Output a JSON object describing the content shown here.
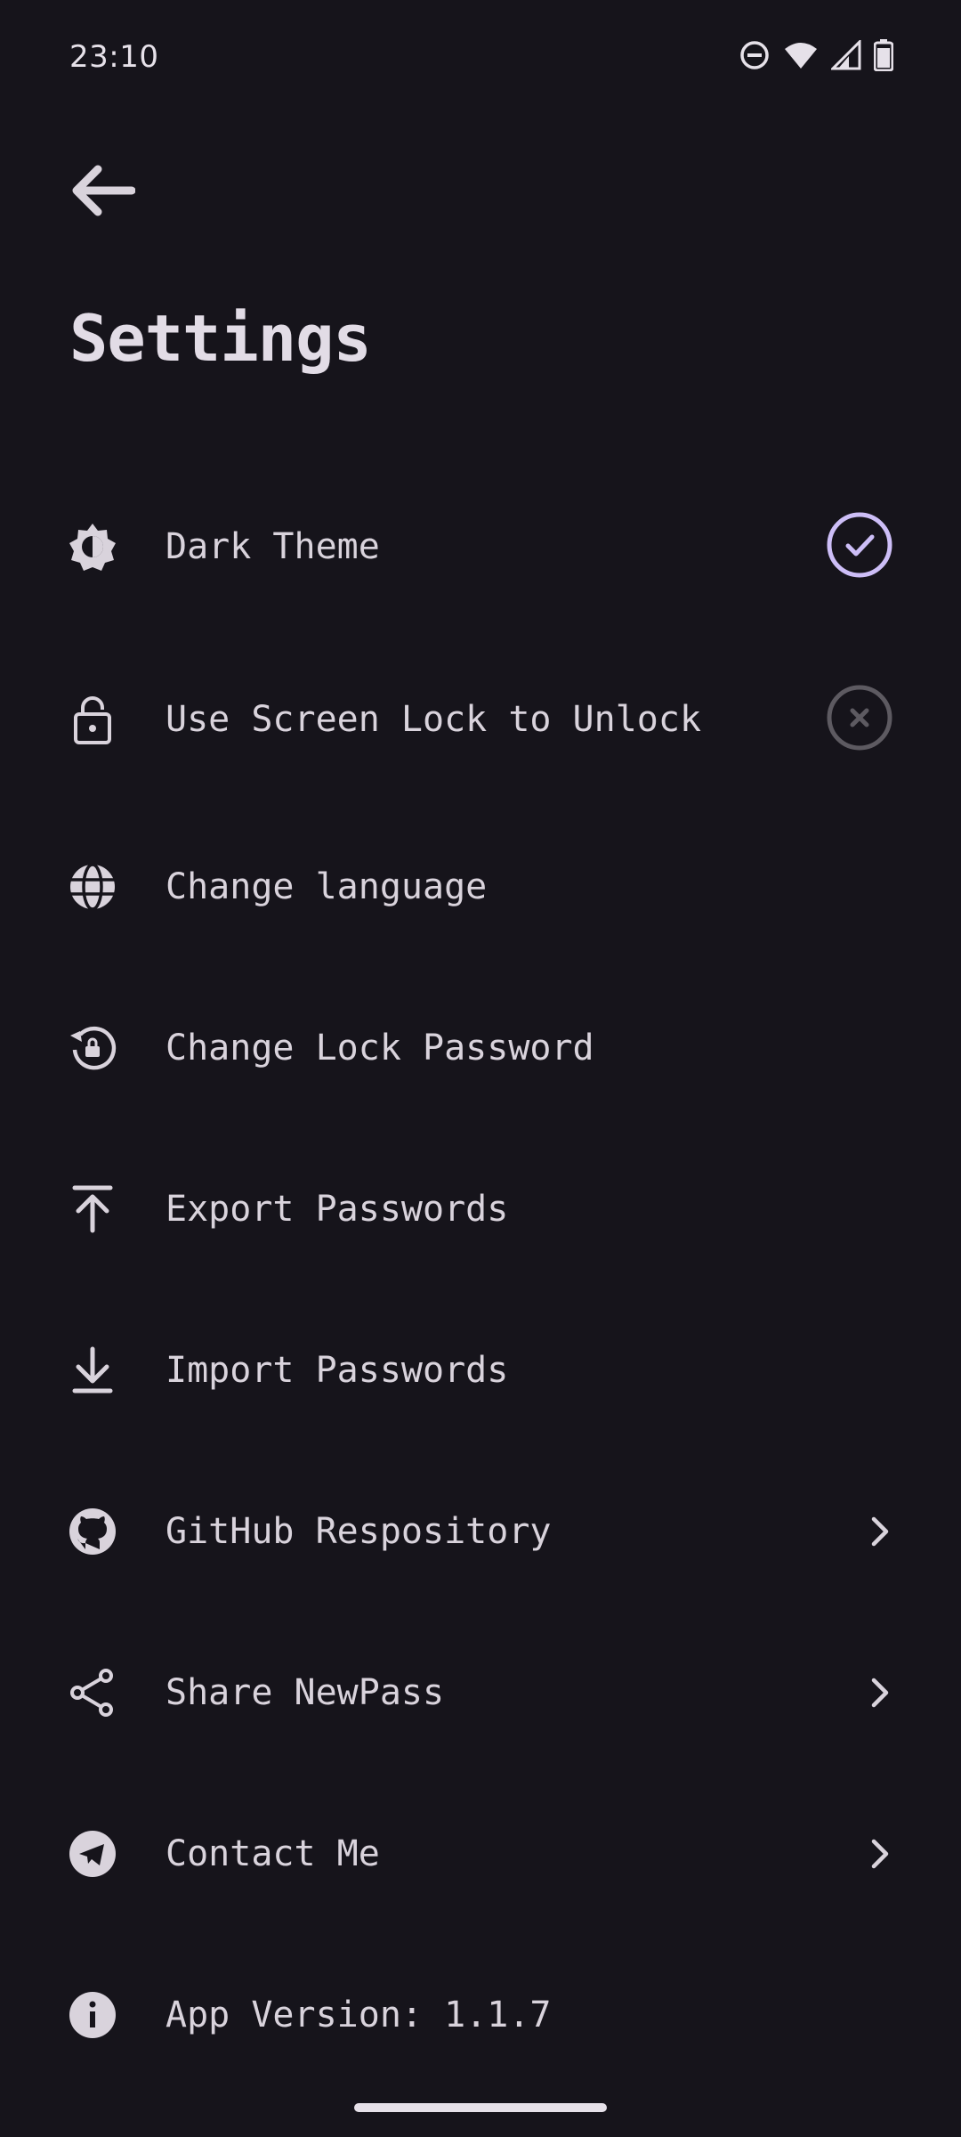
{
  "status_bar": {
    "time": "23:10",
    "icons": [
      "do-not-disturb-icon",
      "wifi-icon",
      "cellular-signal-icon",
      "battery-icon"
    ]
  },
  "header": {
    "back_icon": "arrow-back-icon",
    "title": "Settings"
  },
  "settings": [
    {
      "id": "dark-theme",
      "icon": "brightness-icon",
      "label": "Dark Theme",
      "trailing": "check-circle",
      "state": "enabled"
    },
    {
      "id": "screen-lock",
      "icon": "lock-icon",
      "label": "Use Screen Lock to Unlock",
      "trailing": "x-circle",
      "state": "disabled"
    },
    {
      "id": "change-language",
      "icon": "globe-icon",
      "label": "Change language",
      "trailing": "none"
    },
    {
      "id": "change-lock-password",
      "icon": "lock-reset-icon",
      "label": "Change Lock Password",
      "trailing": "none"
    },
    {
      "id": "export-passwords",
      "icon": "upload-icon",
      "label": "Export Passwords",
      "trailing": "none"
    },
    {
      "id": "import-passwords",
      "icon": "download-icon",
      "label": "Import Passwords",
      "trailing": "none"
    },
    {
      "id": "github-repository",
      "icon": "github-icon",
      "label": "GitHub Respository",
      "trailing": "chevron"
    },
    {
      "id": "share-newpass",
      "icon": "share-icon",
      "label": "Share NewPass",
      "trailing": "chevron"
    },
    {
      "id": "contact-me",
      "icon": "telegram-icon",
      "label": "Contact Me",
      "trailing": "chevron"
    },
    {
      "id": "app-version",
      "icon": "info-icon",
      "label": "App Version: 1.1.7",
      "trailing": "none"
    }
  ],
  "colors": {
    "background": "#16141b",
    "text": "#d9d3dc",
    "accent": "#cdbef7",
    "disabled": "#5d5a61"
  }
}
